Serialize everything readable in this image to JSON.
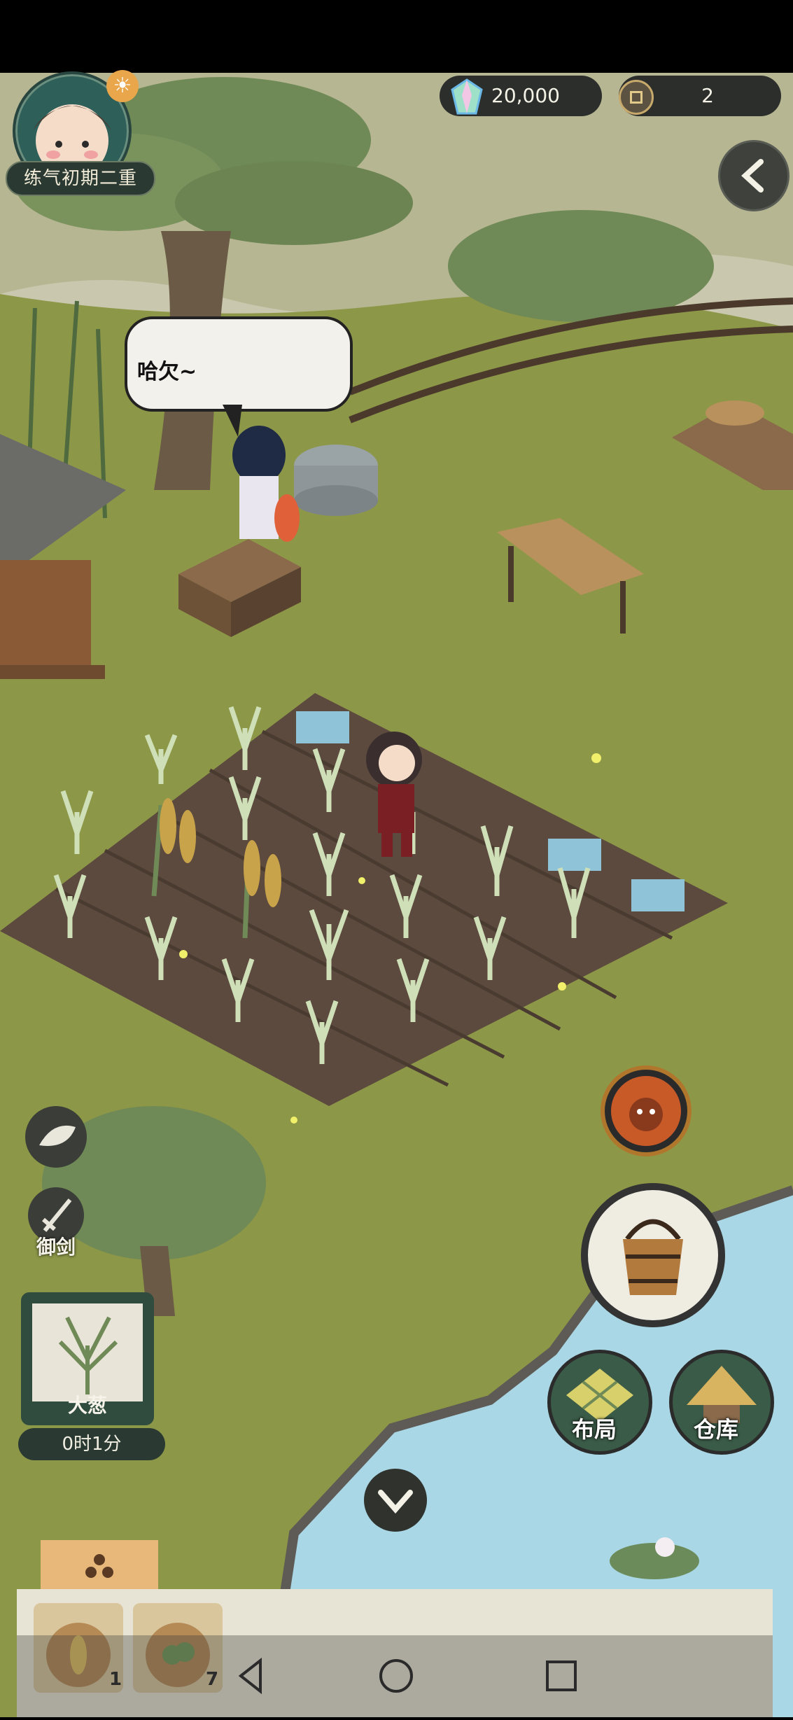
{
  "player": {
    "realm": "练气初期二重"
  },
  "currency": {
    "crystals": "20,000",
    "coins": "2"
  },
  "speech": {
    "text": "哈欠~"
  },
  "actions": {
    "fly_sword_label": "御剑",
    "layout_label": "布局",
    "storage_label": "仓库"
  },
  "current_crop": {
    "name": "大葱",
    "timer": "0时1分"
  },
  "seed_tray": {
    "slots": [
      {
        "icon": "seed-bag-wheat-icon",
        "count": "1"
      },
      {
        "icon": "seed-bag-leaf-icon",
        "count": "7"
      }
    ]
  },
  "colors": {
    "grass": "#8d9748",
    "soil": "#5c4a3e",
    "water": "#a9d7e5",
    "sky_mist": "#c9c7ad",
    "hud_dark": "#2b2e2a"
  }
}
